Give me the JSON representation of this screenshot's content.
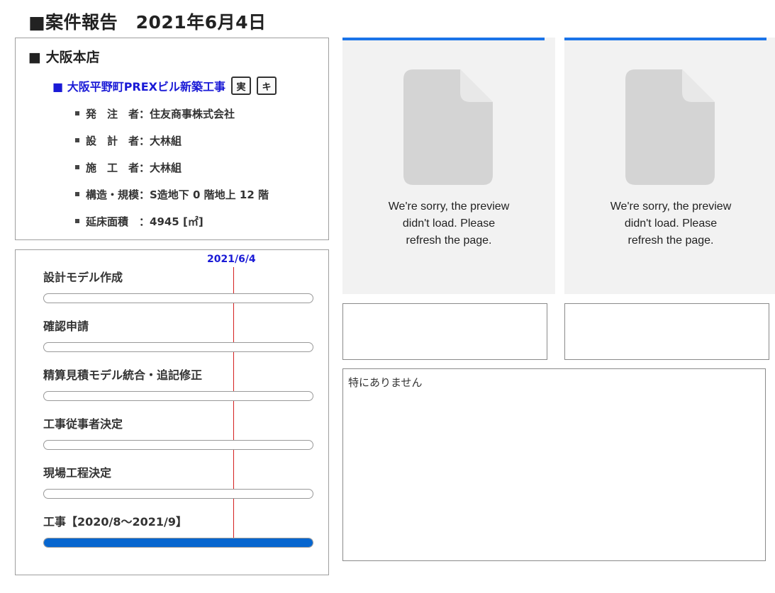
{
  "page": {
    "title": "■案件報告　2021年6月4日"
  },
  "info": {
    "office": "■ 大阪本店",
    "project_name": "■ 大阪平野町PREXビル新築工事",
    "badges": [
      "実",
      "キ"
    ],
    "details": [
      "発　注　者：住友商事株式会社",
      "設　計　者：大林組",
      "施　工　者：大林組",
      "構造・規模：S造地下 0 階地上 12 階",
      "延床面積　：4945 [㎡]"
    ]
  },
  "schedule": {
    "today_label": "2021/6/4",
    "tasks": [
      {
        "label": "設計モデル作成",
        "progress": 0
      },
      {
        "label": "確認申請",
        "progress": 0
      },
      {
        "label": "精算見積モデル統合・追記修正",
        "progress": 0
      },
      {
        "label": "工事従事者決定",
        "progress": 0
      },
      {
        "label": "現場工程決定",
        "progress": 0
      },
      {
        "label": "工事【2020/8～2021/9】",
        "progress": 100
      }
    ]
  },
  "previews": [
    {
      "message": "We're sorry, the preview didn't load. Please refresh the page."
    },
    {
      "message": "We're sorry, the preview didn't load. Please refresh the page."
    }
  ],
  "comment": {
    "text": "特にありません"
  },
  "colors": {
    "accent": "#0766cf",
    "link": "#1a1ad6",
    "marker": "#d42020",
    "preview_bar": "#1a73e8"
  },
  "icons": {
    "preview": "document-icon"
  }
}
